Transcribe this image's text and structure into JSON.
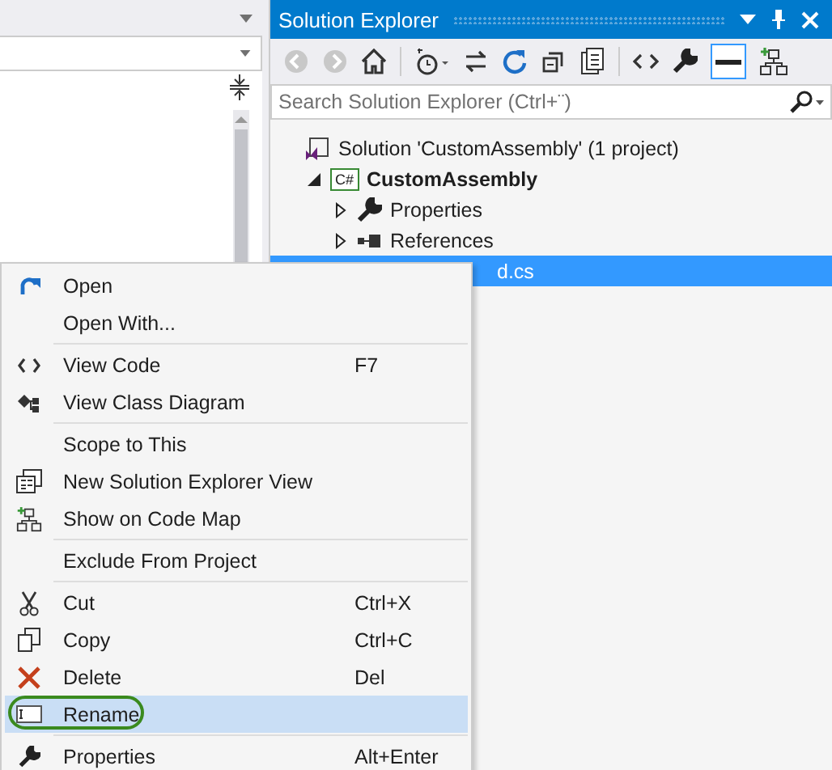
{
  "solution_explorer": {
    "title": "Solution Explorer",
    "search": {
      "placeholder": "Search Solution Explorer (Ctrl+¨)"
    },
    "tree": [
      {
        "kind": "solution",
        "label": "Solution 'CustomAssembly' (1 project)",
        "bold": false,
        "selected": false,
        "children": [
          {
            "kind": "project",
            "badge": "C#",
            "label": "CustomAssembly",
            "bold": true,
            "selected": false,
            "expanded": true,
            "children": [
              {
                "kind": "properties",
                "label": "Properties",
                "bold": false,
                "selected": false,
                "expanded": false
              },
              {
                "kind": "references",
                "label": "References",
                "bold": false,
                "selected": false,
                "expanded": false
              },
              {
                "kind": "file",
                "label": "d.cs",
                "bold": false,
                "selected": true
              }
            ]
          }
        ]
      }
    ]
  },
  "context_menu": {
    "items": [
      {
        "kind": "open",
        "label": "Open",
        "selected": false,
        "circled": false
      },
      {
        "kind": "plain",
        "label": "Open With...",
        "selected": false,
        "circled": false
      },
      {
        "kind": "separator"
      },
      {
        "kind": "code",
        "label": "View Code",
        "shortcut": "F7",
        "selected": false,
        "circled": false
      },
      {
        "kind": "classdiagram",
        "label": "View Class Diagram",
        "selected": false,
        "circled": false
      },
      {
        "kind": "separator"
      },
      {
        "kind": "plain",
        "label": "Scope to This",
        "selected": false,
        "circled": false
      },
      {
        "kind": "newview",
        "label": "New Solution Explorer View",
        "selected": false,
        "circled": false
      },
      {
        "kind": "codemap",
        "label": "Show on Code Map",
        "selected": false,
        "circled": false
      },
      {
        "kind": "separator"
      },
      {
        "kind": "plain",
        "label": "Exclude From Project",
        "selected": false,
        "circled": false
      },
      {
        "kind": "separator"
      },
      {
        "kind": "cut",
        "label": "Cut",
        "shortcut": "Ctrl+X",
        "selected": false,
        "circled": false
      },
      {
        "kind": "copy",
        "label": "Copy",
        "shortcut": "Ctrl+C",
        "selected": false,
        "circled": false
      },
      {
        "kind": "delete",
        "label": "Delete",
        "shortcut": "Del",
        "selected": false,
        "circled": false
      },
      {
        "kind": "rename",
        "label": "Rename",
        "selected": true,
        "circled": true
      },
      {
        "kind": "separator"
      },
      {
        "kind": "properties",
        "label": "Properties",
        "shortcut": "Alt+Enter",
        "selected": false,
        "circled": false
      }
    ]
  }
}
